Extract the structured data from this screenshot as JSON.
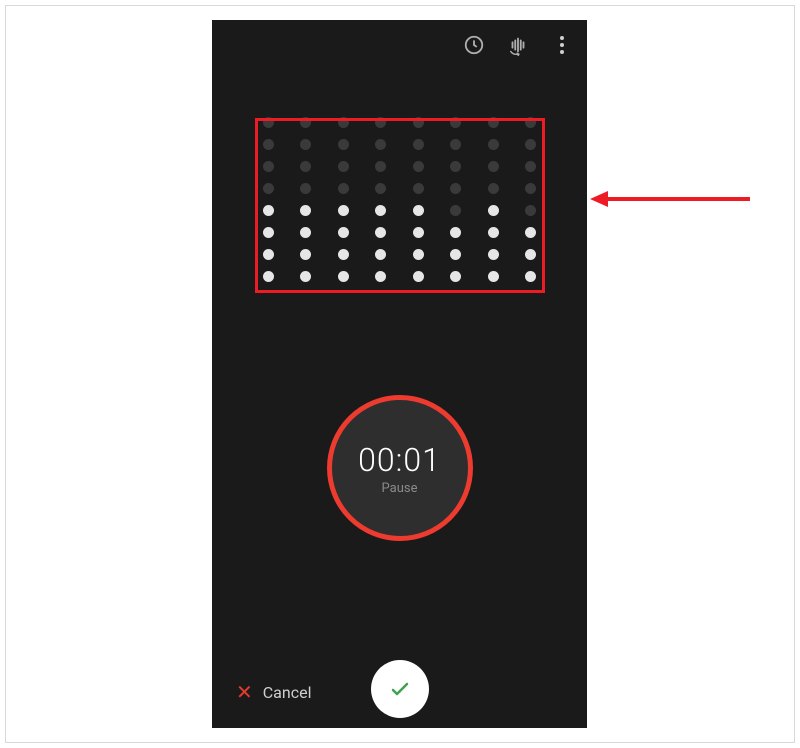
{
  "recorder": {
    "time": "00:01",
    "state_label": "Pause",
    "cancel_label": "Cancel"
  },
  "waveform": {
    "max_height": 8,
    "columns": [
      4,
      4,
      4,
      4,
      4,
      3,
      4,
      3
    ]
  },
  "colors": {
    "accent": "#ed3b2f",
    "highlight": "#ed1c24",
    "check": "#3fa24f"
  }
}
